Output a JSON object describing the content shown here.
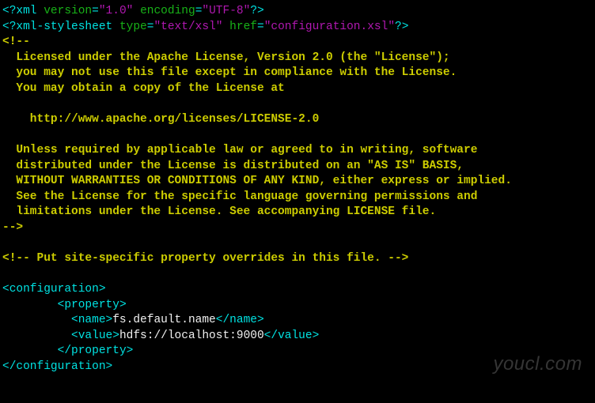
{
  "line1": {
    "open": "<?xml ",
    "attrs": [
      {
        "n": "version",
        "v": "\"1.0\""
      },
      {
        "n": "encoding",
        "v": "\"UTF-8\""
      }
    ],
    "close": "?>"
  },
  "line2": {
    "open": "<?xml-stylesheet ",
    "attrs": [
      {
        "n": "type",
        "v": "\"text/xsl\""
      },
      {
        "n": "href",
        "v": "\"configuration.xsl\""
      }
    ],
    "close": "?>"
  },
  "comment_license": "<!--\n  Licensed under the Apache License, Version 2.0 (the \"License\");\n  you may not use this file except in compliance with the License.\n  You may obtain a copy of the License at\n\n    http://www.apache.org/licenses/LICENSE-2.0\n\n  Unless required by applicable law or agreed to in writing, software\n  distributed under the License is distributed on an \"AS IS\" BASIS,\n  WITHOUT WARRANTIES OR CONDITIONS OF ANY KIND, either express or implied.\n  See the License for the specific language governing permissions and\n  limitations under the License. See accompanying LICENSE file.\n-->",
  "comment_site": "<!-- Put site-specific property overrides in this file. -->",
  "tags": {
    "config_open": "<configuration>",
    "prop_open": "<property>",
    "name_open": "<name>",
    "name_close": "</name>",
    "value_open": "<value>",
    "value_close": "</value>",
    "prop_close": "</property>",
    "config_close": "</configuration>"
  },
  "values": {
    "name": "fs.default.name",
    "value": "hdfs://localhost:9000"
  },
  "indents": {
    "i8": "        ",
    "i10": "          ",
    "i10b": "          "
  },
  "watermark": "youcl.com"
}
